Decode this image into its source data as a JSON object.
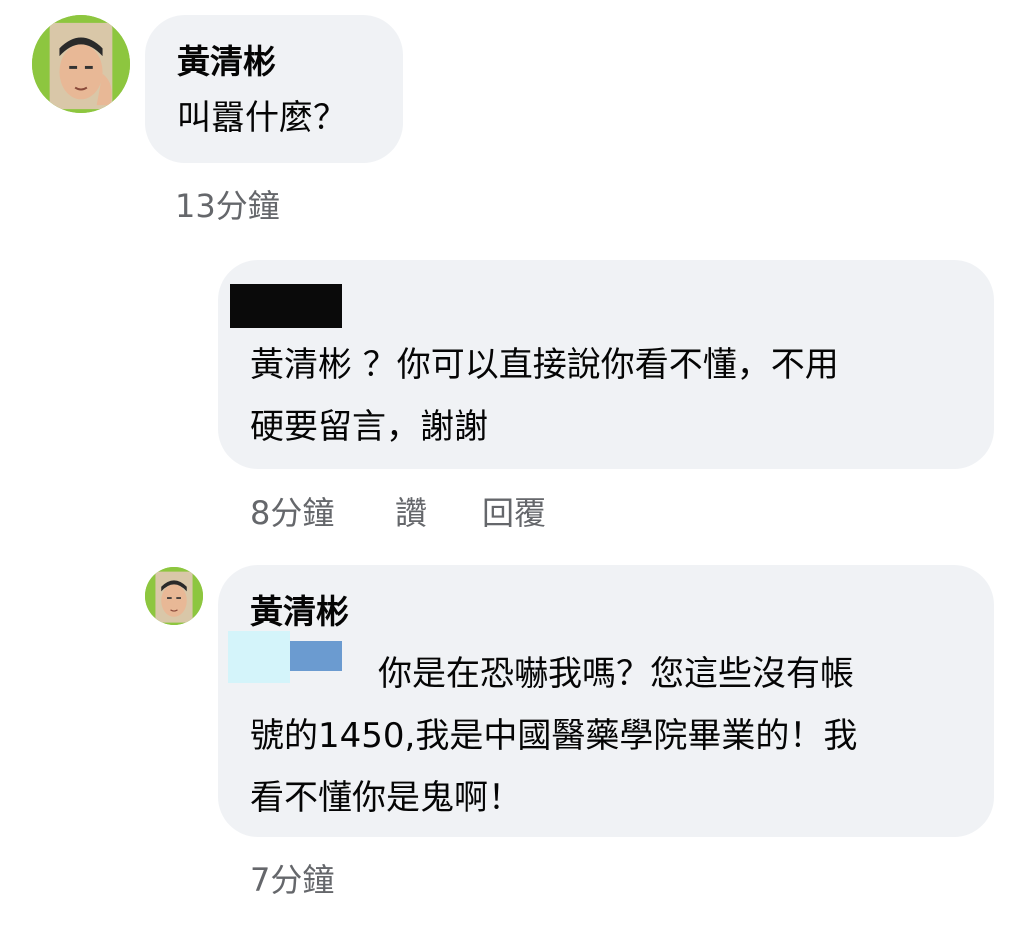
{
  "comments": [
    {
      "author": "黃清彬",
      "avatar_icon": "user-photo",
      "lines": [
        "叫囂什麼？"
      ],
      "time": "13分鐘"
    },
    {
      "author": "",
      "author_redacted": true,
      "lines": [
        "黃清彬 ？你可以直接說你看不懂，不用",
        "硬要留言，謝謝"
      ],
      "time": "8分鐘",
      "like_label": "讚",
      "reply_label": "回覆"
    },
    {
      "author": "黃清彬",
      "avatar_icon": "user-photo",
      "mention_redacted": true,
      "lines": [
        "你是在恐嚇我嗎？您這些沒有帳",
        "號的1450,我是中國醫藥學院畢業的！我",
        "看不懂你是鬼啊！"
      ],
      "time": "7分鐘"
    }
  ],
  "colors": {
    "bubble": "#f0f2f5",
    "text": "#050505",
    "meta": "#65676b",
    "avatar_ring": "#8dc63f"
  }
}
